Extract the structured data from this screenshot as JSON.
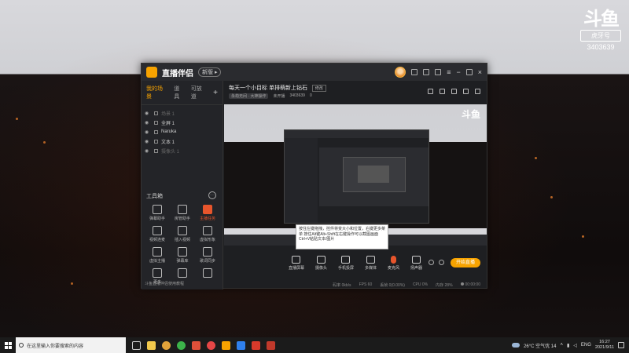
{
  "watermark": {
    "logo": "斗鱼",
    "badge": "虎牙号",
    "room_id": "3403639"
  },
  "app": {
    "title": "直播伴侣",
    "version_badge": "新版 ▸",
    "left_tabs": [
      "我的场景",
      "道具",
      "可放道"
    ],
    "scenes": [
      {
        "name": "场景 1",
        "dim": true
      },
      {
        "name": "全屏 1",
        "dim": false
      },
      {
        "name": "Naruka",
        "dim": false
      },
      {
        "name": "文本 1",
        "dim": false
      },
      {
        "name": "摄像头 1",
        "dim": true
      }
    ],
    "tools_title": "工具箱",
    "tools_more": "···",
    "tools": [
      {
        "label": "弹幕助手",
        "hot": false
      },
      {
        "label": "房管助手",
        "hot": false
      },
      {
        "label": "主播任务",
        "hot": true
      },
      {
        "label": "视频连麦",
        "hot": false
      },
      {
        "label": "插入视频",
        "hot": false
      },
      {
        "label": "虚拟形象",
        "hot": false
      },
      {
        "label": "虚拟主播",
        "hot": false
      },
      {
        "label": "弹幕库",
        "hot": false
      },
      {
        "label": "歌词同步",
        "hot": false
      },
      {
        "label": "更多",
        "hot": false
      },
      {
        "label": "",
        "hot": false
      },
      {
        "label": "",
        "hot": false
      }
    ],
    "footer": "斗鱼直播伴侣使用教程",
    "stream_title": "每天一个小目标 单排萌新上钻石",
    "edit_label": "修改",
    "meta": {
      "category": "永劫无间 · 大神操作",
      "status": "未开播",
      "room": "3403639",
      "likes": "0"
    },
    "tooltip": "按住左键拖拽，控件将变大小和位置，右键更多菜单 按住Alt键Alt+Shift在右键操作可以截图画面 Ctrl+V粘贴文本/图片",
    "controls": [
      {
        "label": "直播屏幕",
        "mic": false
      },
      {
        "label": "摄像头",
        "mic": false
      },
      {
        "label": "手机投屏",
        "mic": false
      },
      {
        "label": "多媒体",
        "mic": false
      },
      {
        "label": "麦克风",
        "mic": true
      },
      {
        "label": "扬声器",
        "mic": false
      }
    ],
    "start_button": "开始直播",
    "status": {
      "bitrate": "码率 0kb/s",
      "fps": "FPS 60",
      "loss": "丢帧 0(0.00%)",
      "cpu": "CPU 0%",
      "mem": "内存 28%",
      "time": "00:00:00"
    }
  },
  "taskbar": {
    "search_placeholder": "在这里输入你要搜索的内容",
    "weather": "26°C 空气优 14",
    "lang": "ENG",
    "time": "16:27",
    "date": "2021/9/11"
  }
}
